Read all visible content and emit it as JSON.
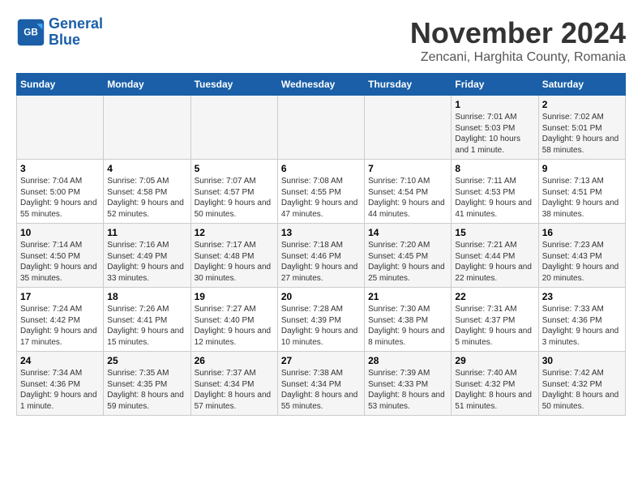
{
  "logo": {
    "line1": "General",
    "line2": "Blue"
  },
  "title": "November 2024",
  "subtitle": "Zencani, Harghita County, Romania",
  "days_header": [
    "Sunday",
    "Monday",
    "Tuesday",
    "Wednesday",
    "Thursday",
    "Friday",
    "Saturday"
  ],
  "weeks": [
    [
      {
        "day": "",
        "detail": ""
      },
      {
        "day": "",
        "detail": ""
      },
      {
        "day": "",
        "detail": ""
      },
      {
        "day": "",
        "detail": ""
      },
      {
        "day": "",
        "detail": ""
      },
      {
        "day": "1",
        "detail": "Sunrise: 7:01 AM\nSunset: 5:03 PM\nDaylight: 10 hours and 1 minute."
      },
      {
        "day": "2",
        "detail": "Sunrise: 7:02 AM\nSunset: 5:01 PM\nDaylight: 9 hours and 58 minutes."
      }
    ],
    [
      {
        "day": "3",
        "detail": "Sunrise: 7:04 AM\nSunset: 5:00 PM\nDaylight: 9 hours and 55 minutes."
      },
      {
        "day": "4",
        "detail": "Sunrise: 7:05 AM\nSunset: 4:58 PM\nDaylight: 9 hours and 52 minutes."
      },
      {
        "day": "5",
        "detail": "Sunrise: 7:07 AM\nSunset: 4:57 PM\nDaylight: 9 hours and 50 minutes."
      },
      {
        "day": "6",
        "detail": "Sunrise: 7:08 AM\nSunset: 4:55 PM\nDaylight: 9 hours and 47 minutes."
      },
      {
        "day": "7",
        "detail": "Sunrise: 7:10 AM\nSunset: 4:54 PM\nDaylight: 9 hours and 44 minutes."
      },
      {
        "day": "8",
        "detail": "Sunrise: 7:11 AM\nSunset: 4:53 PM\nDaylight: 9 hours and 41 minutes."
      },
      {
        "day": "9",
        "detail": "Sunrise: 7:13 AM\nSunset: 4:51 PM\nDaylight: 9 hours and 38 minutes."
      }
    ],
    [
      {
        "day": "10",
        "detail": "Sunrise: 7:14 AM\nSunset: 4:50 PM\nDaylight: 9 hours and 35 minutes."
      },
      {
        "day": "11",
        "detail": "Sunrise: 7:16 AM\nSunset: 4:49 PM\nDaylight: 9 hours and 33 minutes."
      },
      {
        "day": "12",
        "detail": "Sunrise: 7:17 AM\nSunset: 4:48 PM\nDaylight: 9 hours and 30 minutes."
      },
      {
        "day": "13",
        "detail": "Sunrise: 7:18 AM\nSunset: 4:46 PM\nDaylight: 9 hours and 27 minutes."
      },
      {
        "day": "14",
        "detail": "Sunrise: 7:20 AM\nSunset: 4:45 PM\nDaylight: 9 hours and 25 minutes."
      },
      {
        "day": "15",
        "detail": "Sunrise: 7:21 AM\nSunset: 4:44 PM\nDaylight: 9 hours and 22 minutes."
      },
      {
        "day": "16",
        "detail": "Sunrise: 7:23 AM\nSunset: 4:43 PM\nDaylight: 9 hours and 20 minutes."
      }
    ],
    [
      {
        "day": "17",
        "detail": "Sunrise: 7:24 AM\nSunset: 4:42 PM\nDaylight: 9 hours and 17 minutes."
      },
      {
        "day": "18",
        "detail": "Sunrise: 7:26 AM\nSunset: 4:41 PM\nDaylight: 9 hours and 15 minutes."
      },
      {
        "day": "19",
        "detail": "Sunrise: 7:27 AM\nSunset: 4:40 PM\nDaylight: 9 hours and 12 minutes."
      },
      {
        "day": "20",
        "detail": "Sunrise: 7:28 AM\nSunset: 4:39 PM\nDaylight: 9 hours and 10 minutes."
      },
      {
        "day": "21",
        "detail": "Sunrise: 7:30 AM\nSunset: 4:38 PM\nDaylight: 9 hours and 8 minutes."
      },
      {
        "day": "22",
        "detail": "Sunrise: 7:31 AM\nSunset: 4:37 PM\nDaylight: 9 hours and 5 minutes."
      },
      {
        "day": "23",
        "detail": "Sunrise: 7:33 AM\nSunset: 4:36 PM\nDaylight: 9 hours and 3 minutes."
      }
    ],
    [
      {
        "day": "24",
        "detail": "Sunrise: 7:34 AM\nSunset: 4:36 PM\nDaylight: 9 hours and 1 minute."
      },
      {
        "day": "25",
        "detail": "Sunrise: 7:35 AM\nSunset: 4:35 PM\nDaylight: 8 hours and 59 minutes."
      },
      {
        "day": "26",
        "detail": "Sunrise: 7:37 AM\nSunset: 4:34 PM\nDaylight: 8 hours and 57 minutes."
      },
      {
        "day": "27",
        "detail": "Sunrise: 7:38 AM\nSunset: 4:34 PM\nDaylight: 8 hours and 55 minutes."
      },
      {
        "day": "28",
        "detail": "Sunrise: 7:39 AM\nSunset: 4:33 PM\nDaylight: 8 hours and 53 minutes."
      },
      {
        "day": "29",
        "detail": "Sunrise: 7:40 AM\nSunset: 4:32 PM\nDaylight: 8 hours and 51 minutes."
      },
      {
        "day": "30",
        "detail": "Sunrise: 7:42 AM\nSunset: 4:32 PM\nDaylight: 8 hours and 50 minutes."
      }
    ]
  ]
}
